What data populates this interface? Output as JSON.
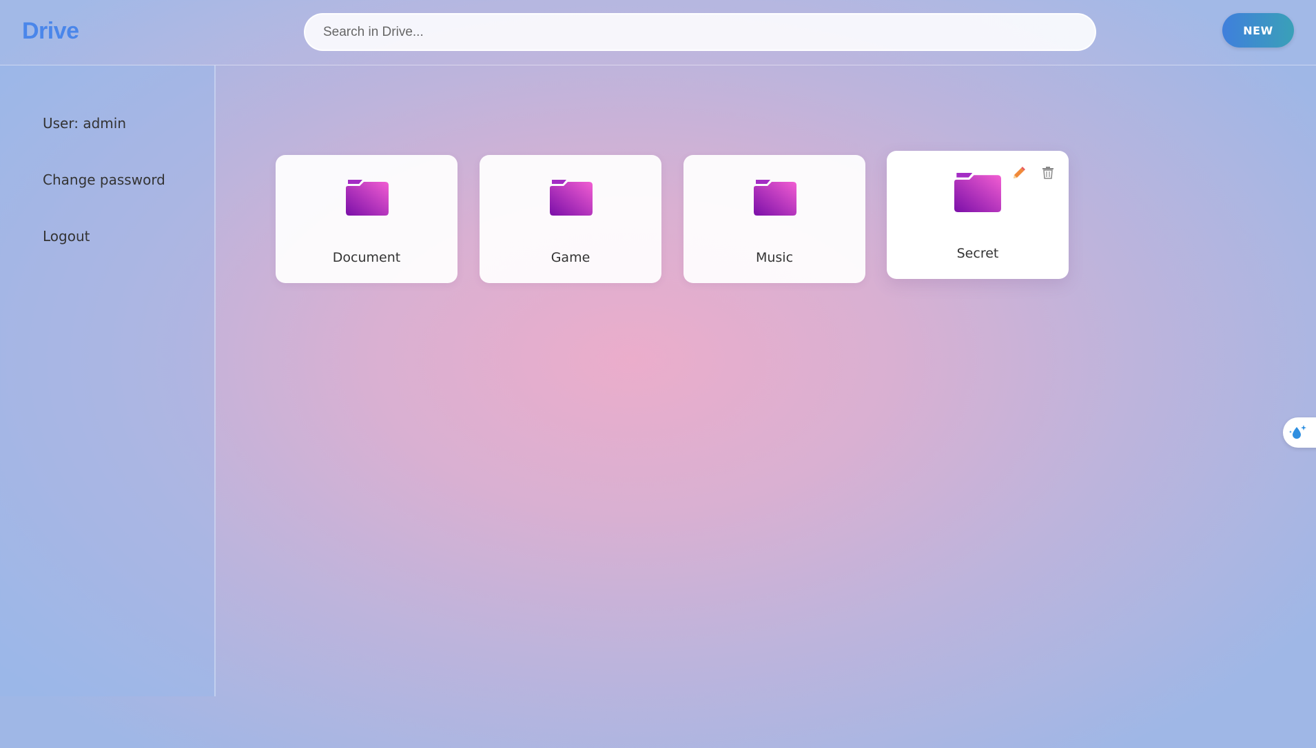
{
  "app": {
    "title": "Drive"
  },
  "search": {
    "placeholder": "Search in Drive...",
    "value": ""
  },
  "header": {
    "new_label": "NEW"
  },
  "sidebar": {
    "items": [
      {
        "label": "User: admin"
      },
      {
        "label": "Change password"
      },
      {
        "label": "Logout"
      }
    ]
  },
  "folders": [
    {
      "name": "Document"
    },
    {
      "name": "Game"
    },
    {
      "name": "Music"
    },
    {
      "name": "Secret"
    }
  ],
  "colors": {
    "brand": "#4a86ea",
    "folder_gradient": [
      "#7a0fa8",
      "#f25ed2"
    ],
    "edit_icon": "#f08a3a",
    "new_button": [
      "#3f7fdc",
      "#3aa0b8"
    ]
  },
  "icons": {
    "folder": "folder-icon",
    "edit": "pencil-icon",
    "delete": "trash-icon",
    "floating_helper": "water-drop-sparkle-icon"
  }
}
